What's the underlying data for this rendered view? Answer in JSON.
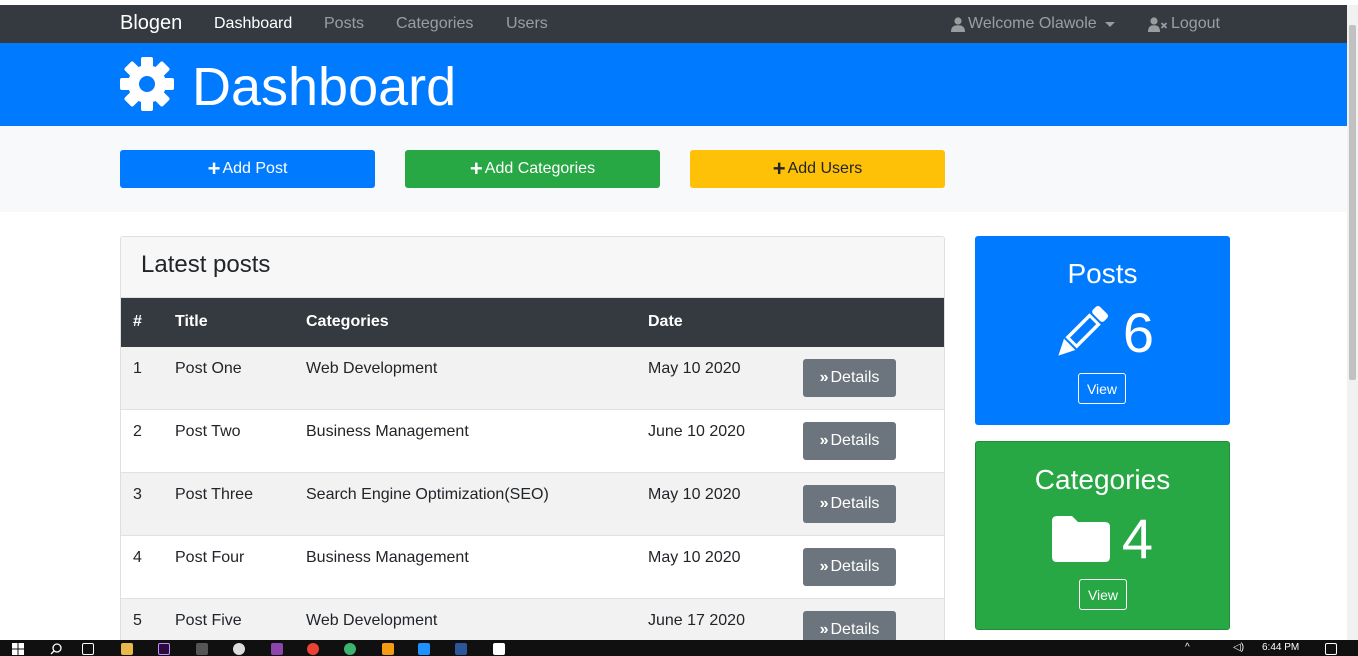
{
  "navbar": {
    "brand": "Blogen",
    "links": [
      "Dashboard",
      "Posts",
      "Categories",
      "Users"
    ],
    "welcome": "Welcome Olawole",
    "logout": "Logout"
  },
  "header": {
    "title": "Dashboard",
    "icon": "gear-icon"
  },
  "actions": {
    "add_post": "Add Post",
    "add_categories": "Add Categories",
    "add_users": "Add Users"
  },
  "colors": {
    "primary": "#007bff",
    "success": "#28a745",
    "warning": "#ffc107",
    "dark": "#343a40",
    "secondary": "#6c757d"
  },
  "posts_card": {
    "title": "Latest posts",
    "columns": [
      "#",
      "Title",
      "Categories",
      "Date"
    ],
    "details_label": "Details",
    "rows": [
      {
        "num": "1",
        "title": "Post One",
        "category": "Web Development",
        "date": "May 10 2020"
      },
      {
        "num": "2",
        "title": "Post Two",
        "category": "Business Management",
        "date": "June 10 2020"
      },
      {
        "num": "3",
        "title": "Post Three",
        "category": "Search Engine Optimization(SEO)",
        "date": "May 10 2020"
      },
      {
        "num": "4",
        "title": "Post Four",
        "category": "Business Management",
        "date": "May 10 2020"
      },
      {
        "num": "5",
        "title": "Post Five",
        "category": "Web Development",
        "date": "June 17 2020"
      }
    ]
  },
  "stats": {
    "posts": {
      "title": "Posts",
      "count": "6",
      "view": "View",
      "icon": "pencil-icon"
    },
    "categories": {
      "title": "Categories",
      "count": "4",
      "view": "View",
      "icon": "folder-icon"
    }
  },
  "taskbar": {
    "time": "6:44 PM"
  }
}
